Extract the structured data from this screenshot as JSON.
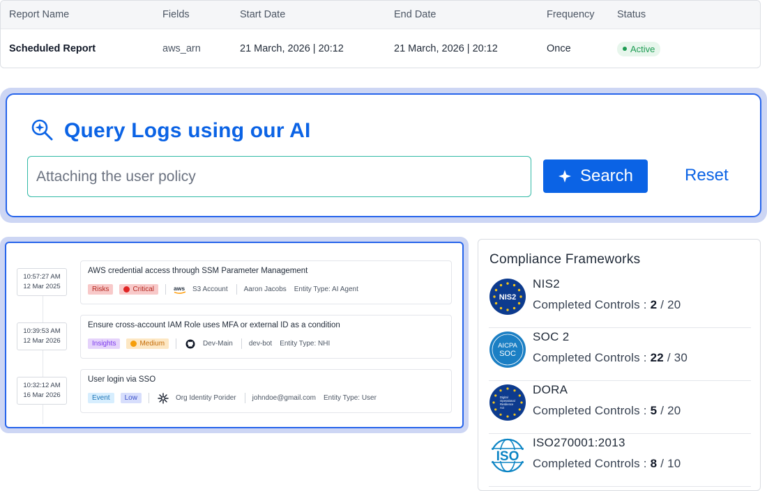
{
  "report_table": {
    "headers": [
      "Report Name",
      "Fields",
      "Start Date",
      "End Date",
      "Frequency",
      "Status"
    ],
    "row": {
      "report_name": "Scheduled Report",
      "fields": "aws_arn",
      "start_date": "21 March, 2026 | 20:12",
      "end_date": "21 March, 2026 | 20:12",
      "frequency": "Once",
      "status": "Active",
      "status_color": "#1e9c53"
    }
  },
  "query": {
    "title": "Query Logs using our AI",
    "icon": "ai-search-icon",
    "input_value": "Attaching the user policy",
    "search_label": "Search",
    "search_icon": "sparkle-icon",
    "reset_label": "Reset",
    "accent": "#0b63e5"
  },
  "events": [
    {
      "time": "10:57:27 AM",
      "date": "12 Mar 2025",
      "title": "AWS credential access through SSM Parameter Management",
      "category": "Risks",
      "severity": "Critical",
      "severity_color": "#e02424",
      "source_icon": "aws-icon",
      "source": "S3 Account",
      "user": "Aaron Jacobs",
      "entity_type": "Entity Type: AI Agent"
    },
    {
      "time": "10:39:53 AM",
      "date": "12 Mar 2026",
      "title": "Ensure cross-account IAM Role uses MFA or external ID as a condition",
      "category": "Insights",
      "severity": "Medium",
      "severity_color": "#f59e0b",
      "source_icon": "github-icon",
      "source": "Dev-Main",
      "user": "dev-bot",
      "entity_type": "Entity Type: NHI"
    },
    {
      "time": "10:32:12 AM",
      "date": "16 Mar 2026",
      "title": "User login via SSO",
      "category": "Event",
      "severity": "Low",
      "source_icon": "okta-icon",
      "source": "Org Identity Porider",
      "user": "johndoe@gmail.com",
      "entity_type": "Entity Type: User"
    }
  ],
  "compliance": {
    "title": "Compliance Frameworks",
    "controls_label": "Completed Controls :",
    "frameworks": [
      {
        "name": "NIS2",
        "logo": "nis2-logo",
        "logo_text": "NIS2",
        "completed": "2",
        "total": "/ 20"
      },
      {
        "name": "SOC 2",
        "logo": "aicpa-soc-logo",
        "logo_text": "AICPA SOC",
        "completed": "22",
        "total": "/ 30"
      },
      {
        "name": "DORA",
        "logo": "dora-logo",
        "logo_text": "Digital Operational Resilience Act",
        "completed": "5",
        "total": "/ 20"
      },
      {
        "name": "ISO270001:2013",
        "logo": "iso-logo",
        "logo_text": "ISO",
        "completed": "8",
        "total": "/ 10"
      }
    ]
  }
}
